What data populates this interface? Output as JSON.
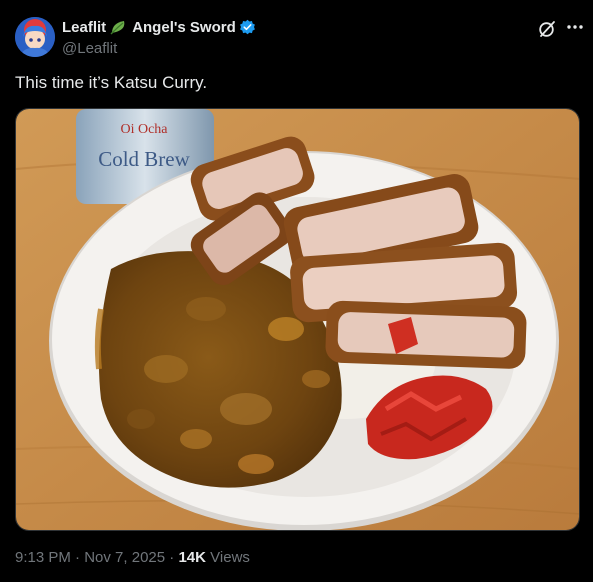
{
  "author": {
    "display_name_prefix": "Leaflit",
    "display_name_suffix": "Angel's Sword",
    "handle": "@Leaflit",
    "leaf_icon": "leaf-emoji-icon",
    "verified_color": "#1d9bf0"
  },
  "tweet": {
    "text": "This time it’s Katsu Curry.",
    "media": {
      "can_brand_line1": "Oi Ocha",
      "can_brand_line2": "Cold Brew"
    }
  },
  "meta": {
    "time": "9:13 PM",
    "separator": "·",
    "date": "Nov 7, 2025",
    "views_count": "14K",
    "views_label": "Views"
  },
  "colors": {
    "background": "#000000",
    "text_primary": "#e7e9ea",
    "text_secondary": "#71767b",
    "accent": "#1d9bf0"
  }
}
